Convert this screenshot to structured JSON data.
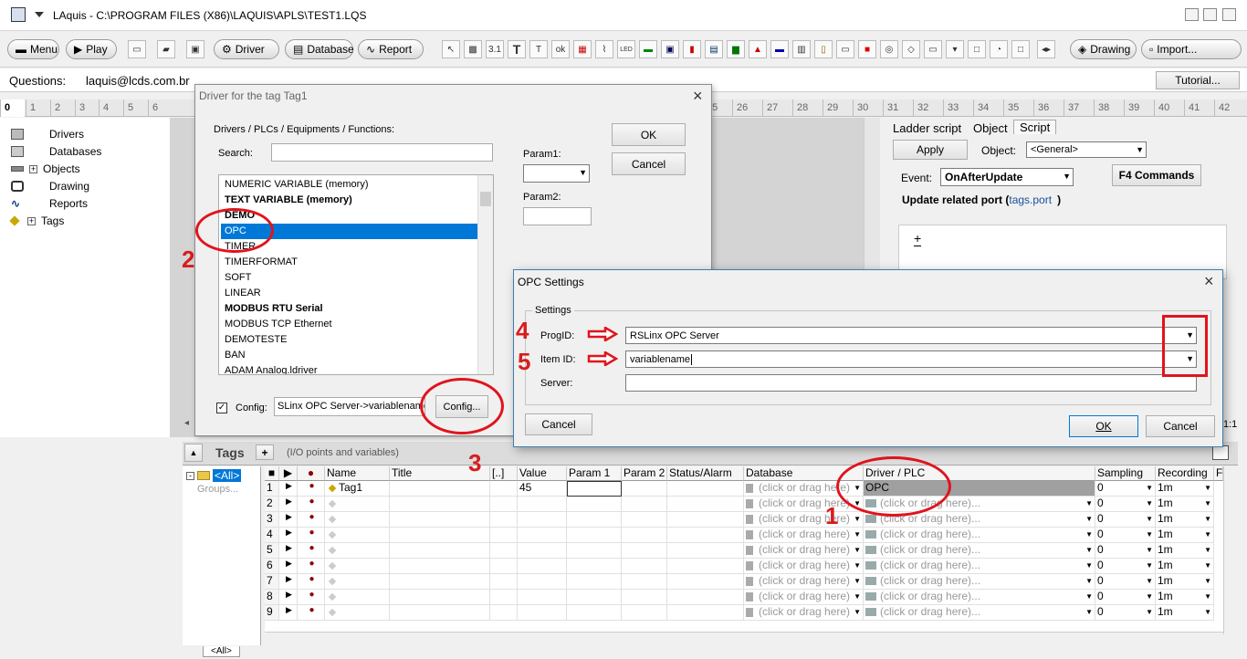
{
  "window": {
    "title": "LAquis - C:\\PROGRAM FILES (X86)\\LAQUIS\\APLS\\TEST1.LQS"
  },
  "toolbar": {
    "menu": "Menu",
    "play": "Play",
    "driver": "Driver",
    "database": "Database",
    "report": "Report",
    "drawing": "Drawing",
    "import": "Import..."
  },
  "questions": {
    "label": "Questions:",
    "email": "laquis@lcds.com.br",
    "tutorial": "Tutorial..."
  },
  "ruler": [
    "0",
    "1",
    "2",
    "3",
    "4",
    "5",
    "6",
    "25",
    "26",
    "27",
    "28",
    "29",
    "30",
    "31",
    "32",
    "33",
    "34",
    "35",
    "36",
    "37",
    "38",
    "39",
    "40",
    "41",
    "42"
  ],
  "tree": [
    "Drivers",
    "Databases",
    "Objects",
    "Drawing",
    "Reports",
    "Tags"
  ],
  "rpanel": {
    "tabs": [
      "Ladder script",
      "Object",
      "Script"
    ],
    "apply": "Apply",
    "object_label": "Object:",
    "object_value": "<General>",
    "event_label": "Event:",
    "event_value": "OnAfterUpdate",
    "f4": "F4 Commands",
    "update_text": "Update related port (",
    "update_link": "tags.port",
    "update_end": ")",
    "plus": "+",
    "ratio": "1:1"
  },
  "driver_dialog": {
    "title": "Driver for the tag Tag1",
    "heading": "Drivers / PLCs / Equipments / Functions:",
    "search_label": "Search:",
    "param1": "Param1:",
    "param2": "Param2:",
    "ok": "OK",
    "cancel": "Cancel",
    "items": [
      "NUMERIC VARIABLE (memory)",
      "TEXT VARIABLE (memory)",
      "DEMO",
      "OPC",
      "TIMER",
      "TIMERFORMAT",
      "SOFT",
      "LINEAR",
      "MODBUS RTU Serial",
      "MODBUS TCP Ethernet",
      "DEMOTESTE",
      "BAN",
      "ADAM Analog.ldriver"
    ],
    "selected": "OPC",
    "config_label": "Config:",
    "config_value": "SLinx OPC Server->variablename",
    "config_button": "Config..."
  },
  "opc_dialog": {
    "title": "OPC Settings",
    "group": "Settings",
    "progid_label": "ProgID:",
    "progid_value": "RSLinx OPC Server",
    "itemid_label": "Item ID:",
    "itemid_value": "variablename",
    "server_label": "Server:",
    "server_value": "",
    "cancel_left": "Cancel",
    "ok": "OK",
    "cancel": "Cancel"
  },
  "annotations": [
    "1",
    "2",
    "3",
    "4",
    "5"
  ],
  "tags": {
    "title": "Tags",
    "add": "+",
    "subtitle": "(I/O points and variables)",
    "groups_all": "<All>",
    "groups_placeholder": "Groups...",
    "bottom_tab": "<All>",
    "columns": [
      "■",
      "▶",
      "●",
      "Name",
      "Title",
      "[..]",
      "Value",
      "Param 1",
      "Param 2",
      "Status/Alarm",
      "Database",
      "Driver / PLC",
      "Sampling",
      "Recording",
      "F"
    ],
    "rows": [
      {
        "n": "1",
        "name": "Tag1",
        "value": "45",
        "database": "(click or drag here)",
        "driver": "OPC",
        "sampling": "0",
        "recording": "1m"
      },
      {
        "n": "2",
        "name": "",
        "value": "",
        "database": "(click or drag here)",
        "driver": "(click or drag here)...",
        "sampling": "0",
        "recording": "1m"
      },
      {
        "n": "3",
        "name": "",
        "value": "",
        "database": "(click or drag here)",
        "driver": "(click or drag here)...",
        "sampling": "0",
        "recording": "1m"
      },
      {
        "n": "4",
        "name": "",
        "value": "",
        "database": "(click or drag here)",
        "driver": "(click or drag here)...",
        "sampling": "0",
        "recording": "1m"
      },
      {
        "n": "5",
        "name": "",
        "value": "",
        "database": "(click or drag here)",
        "driver": "(click or drag here)...",
        "sampling": "0",
        "recording": "1m"
      },
      {
        "n": "6",
        "name": "",
        "value": "",
        "database": "(click or drag here)",
        "driver": "(click or drag here)...",
        "sampling": "0",
        "recording": "1m"
      },
      {
        "n": "7",
        "name": "",
        "value": "",
        "database": "(click or drag here)",
        "driver": "(click or drag here)...",
        "sampling": "0",
        "recording": "1m"
      },
      {
        "n": "8",
        "name": "",
        "value": "",
        "database": "(click or drag here)",
        "driver": "(click or drag here)...",
        "sampling": "0",
        "recording": "1m"
      },
      {
        "n": "9",
        "name": "",
        "value": "",
        "database": "(click or drag here)",
        "driver": "(click or drag here)...",
        "sampling": "0",
        "recording": "1m"
      }
    ]
  },
  "colors": {
    "selection": "#0078d7",
    "annotation": "#e0141c",
    "link": "#1a4fa0"
  }
}
